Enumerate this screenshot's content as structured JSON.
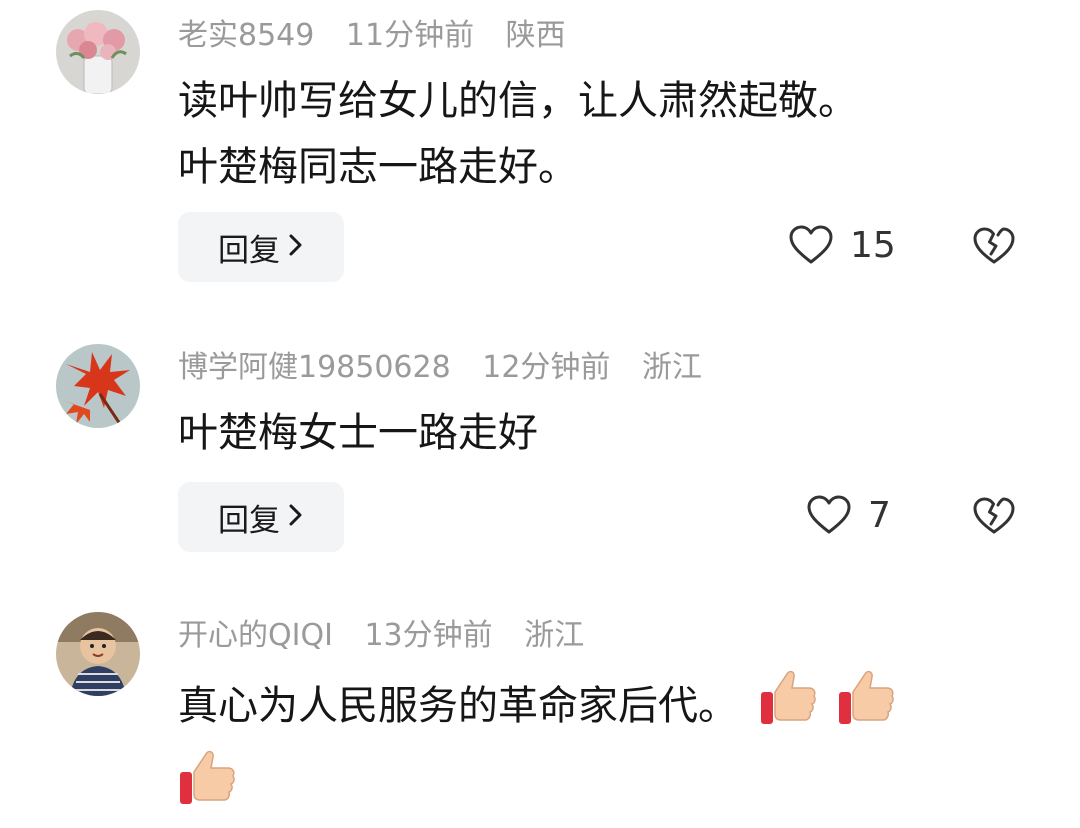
{
  "comments": [
    {
      "username": "老实8549",
      "time": "11分钟前",
      "location": "陕西",
      "lines": [
        "读叶帅写给女儿的信，让人肃然起敬。",
        "叶楚梅同志一路走好。"
      ],
      "reply_label": "回复",
      "likes": "15",
      "avatar": "rose-vase-avatar"
    },
    {
      "username": "博学阿健19850628",
      "time": "12分钟前",
      "location": "浙江",
      "lines": [
        "叶楚梅女士一路走好"
      ],
      "reply_label": "回复",
      "likes": "7",
      "avatar": "red-maple-avatar"
    },
    {
      "username": "开心的QIQI",
      "time": "13分钟前",
      "location": "浙江",
      "lines": [
        "真心为人民服务的革命家后代。"
      ],
      "emoji": [
        "thumbs-up",
        "thumbs-up",
        "thumbs-up"
      ],
      "avatar": "child-photo-avatar"
    }
  ],
  "icons": {
    "like": "heart-outline-icon",
    "dislike": "broken-heart-icon",
    "reply_chevron": "chevron-right-icon"
  },
  "colors": {
    "meta_text": "#9a9a9a",
    "reply_bg": "#f3f4f6",
    "thumb_red": "#e0303f",
    "thumb_skin": "#f6cba6"
  }
}
